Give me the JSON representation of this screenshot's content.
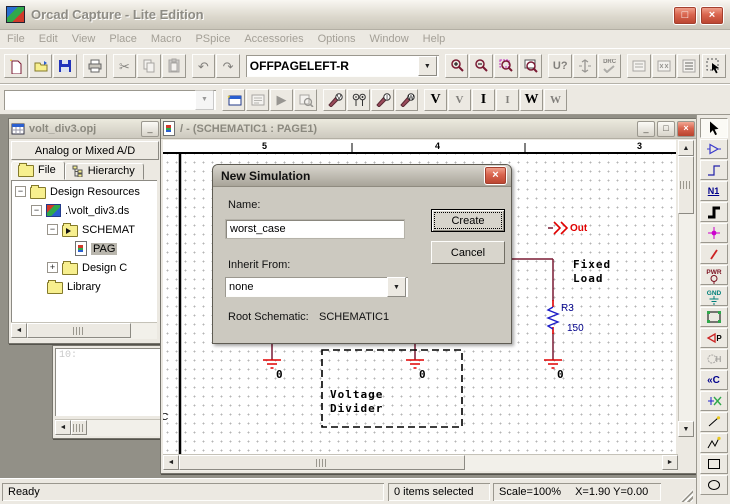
{
  "titlebar": {
    "title": "Orcad Capture - Lite Edition"
  },
  "glyphs": {
    "minimize": "_",
    "maximize": "□",
    "close": "×",
    "dropdown": "▼",
    "left": "◄",
    "right": "►",
    "up": "▲",
    "down": "▼",
    "expand": "+",
    "collapse": "−",
    "cut": "✂",
    "undo": "↶",
    "redo": "↷",
    "play": "▶"
  },
  "menu": {
    "items": [
      "File",
      "Edit",
      "View",
      "Place",
      "Macro",
      "PSpice",
      "Accessories",
      "Options",
      "Window",
      "Help"
    ]
  },
  "toolbar_main": {
    "part_combo_value": "OFFPAGELEFT-R",
    "annotate_label": "U?",
    "drc_label": "DRC"
  },
  "toolbar_pspice": {
    "profile_combo_value": "",
    "v_label": "V",
    "i_label": "I",
    "w_label": "W"
  },
  "project_window": {
    "title": "volt_div3.opj",
    "header": "Analog or Mixed A/D",
    "tab_file": "File",
    "tab_hierarchy": "Hierarchy",
    "tree": [
      {
        "label": "Design Resources"
      },
      {
        "label": ".\\volt_div3.ds"
      },
      {
        "label": "SCHEMAT"
      },
      {
        "label": "PAG"
      },
      {
        "label": "Design C"
      },
      {
        "label": "Library"
      }
    ]
  },
  "log_window": {
    "text": "10:"
  },
  "schematic_window": {
    "title": "/ - (SCHEMATIC1 : PAGE1)",
    "ruler_cols": [
      "5",
      "4",
      "3"
    ],
    "row_label": "C"
  },
  "dialog": {
    "title": "New Simulation",
    "name_label": "Name:",
    "name_value": "worst_case",
    "create_button": "Create",
    "cancel_button": "Cancel",
    "inherit_label": "Inherit From:",
    "inherit_value": "none",
    "root_schematic_label": "Root Schematic:",
    "root_schematic_value": "SCHEMATIC1"
  },
  "schematic": {
    "out_label": "Out",
    "fixed_load_line1": "Fixed",
    "fixed_load_line2": "Load",
    "r3_ref": "R3",
    "r3_value": "150",
    "gnd1_label": "0",
    "gnd2_label": "0",
    "gnd3_label": "0",
    "divider_line1": "Voltage",
    "divider_line2": "Divider"
  },
  "right_toolbar": {
    "net_alias": "N1",
    "power": "PWR",
    "ground": "GND",
    "offpage": "«C",
    "port": "P",
    "pin": "H"
  },
  "statusbar": {
    "ready": "Ready",
    "selection": "0 items selected",
    "scale": "Scale=100%",
    "coords": "X=1.90 Y=0.00"
  },
  "colors": {
    "wire_maroon": "#7a1a33",
    "symbol_red": "#e00000",
    "resistor_blue": "#1e1ec8",
    "label_navy": "#00008c",
    "close_red": "#d9654f",
    "chrome": "#ece9e2"
  }
}
